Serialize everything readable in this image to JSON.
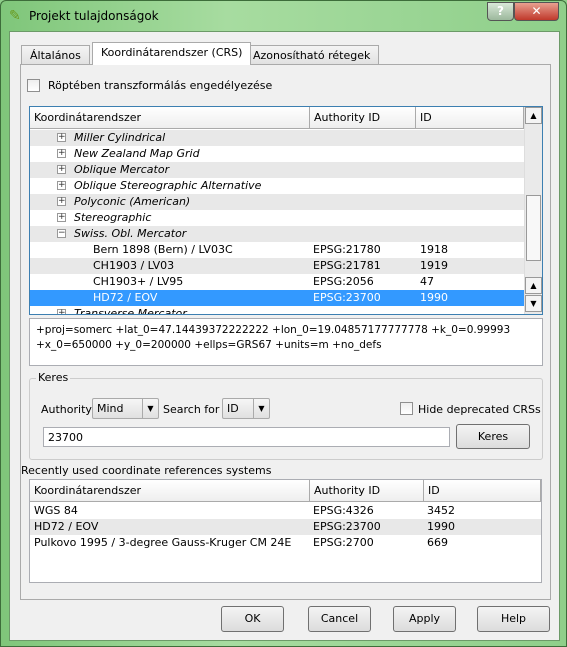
{
  "window": {
    "title": "Projekt tulajdonságok",
    "help_glyph": "?",
    "close_glyph": "✕"
  },
  "tabs": [
    {
      "label": "Általános"
    },
    {
      "label": "Koordinátarendszer (CRS)"
    },
    {
      "label": "Azonosítható rétegek"
    }
  ],
  "otf_checkbox": {
    "label": "Röptében transzformálás engedélyezése",
    "checked": false
  },
  "crs_tree": {
    "columns": [
      "Koordinátarendszer",
      "Authority ID",
      "ID"
    ],
    "rows": [
      {
        "name": "Miller Cylindrical",
        "group": true,
        "expanded": false
      },
      {
        "name": "New Zealand Map Grid",
        "group": true,
        "expanded": false
      },
      {
        "name": "Oblique Mercator",
        "group": true,
        "expanded": false
      },
      {
        "name": "Oblique Stereographic Alternative",
        "group": true,
        "expanded": false
      },
      {
        "name": "Polyconic (American)",
        "group": true,
        "expanded": false
      },
      {
        "name": "Stereographic",
        "group": true,
        "expanded": false
      },
      {
        "name": "Swiss. Obl. Mercator",
        "group": true,
        "expanded": true
      },
      {
        "name": "Bern 1898 (Bern) / LV03C",
        "auth": "EPSG:21780",
        "id": "1918"
      },
      {
        "name": "CH1903 / LV03",
        "auth": "EPSG:21781",
        "id": "1919"
      },
      {
        "name": "CH1903+ / LV95",
        "auth": "EPSG:2056",
        "id": "47"
      },
      {
        "name": "HD72 / EOV",
        "auth": "EPSG:23700",
        "id": "1990",
        "selected": true
      },
      {
        "name": "Transverse Mercator",
        "group": true,
        "expanded": false
      }
    ]
  },
  "proj_string": [
    "+proj=somerc +lat_0=47.14439372222222 +lon_0=19.04857177777778 +k_0=0.99993",
    "+x_0=650000 +y_0=200000 +ellps=GRS67 +units=m +no_defs"
  ],
  "search": {
    "group_label": "Keres",
    "authority_label": "Authority",
    "authority_value": "Mind",
    "search_for_label": "Search for",
    "search_for_value": "ID",
    "hide_deprecated_label": "Hide deprecated CRSs",
    "hide_deprecated_checked": false,
    "query": "23700",
    "button": "Keres"
  },
  "recent": {
    "label": "Recently used coordinate references systems",
    "columns": [
      "Koordinátarendszer",
      "Authority ID",
      "ID"
    ],
    "rows": [
      {
        "name": "WGS 84",
        "auth": "EPSG:4326",
        "id": "3452"
      },
      {
        "name": "HD72 / EOV",
        "auth": "EPSG:23700",
        "id": "1990"
      },
      {
        "name": "Pulkovo 1995 / 3-degree Gauss-Kruger CM 24E",
        "auth": "EPSG:2700",
        "id": "669"
      }
    ]
  },
  "buttons": {
    "ok": "OK",
    "cancel": "Cancel",
    "apply": "Apply",
    "help": "Help"
  },
  "colors": {
    "selection": "#3399ff",
    "frame": "#8fcf8a"
  }
}
